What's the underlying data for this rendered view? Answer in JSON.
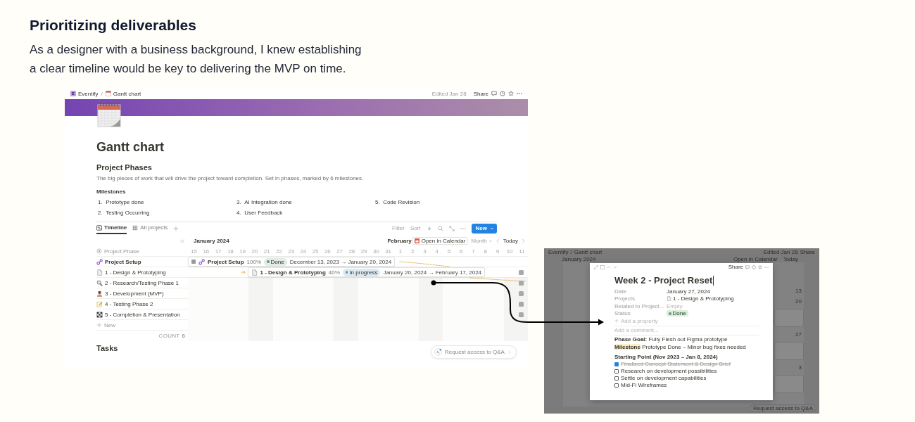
{
  "header": {
    "title": "Prioritizing deliverables",
    "paragraph": [
      "As a designer with a business background, I knew establishing",
      "a clear timeline would be key to delivering the MVP on time."
    ]
  },
  "gantt_page": {
    "breadcrumbs": [
      "Eventify",
      "Gantt chart"
    ],
    "breadcrumb_separator": "/",
    "edited": "Edited Jan 28",
    "share": "Share",
    "title": "Gantt chart",
    "section_title": "Project Phases",
    "description": "The big pieces of work that will drive the project toward completion. Set in phases,  marked by 6 milestones.",
    "milestones_label": "Milestones",
    "milestones": [
      {
        "number": "1.",
        "text": "Prototype done"
      },
      {
        "number": "2.",
        "text": "Testing Occurring"
      },
      {
        "number": "3.",
        "text": "AI Integration done"
      },
      {
        "number": "4.",
        "text": "User Feedback"
      },
      {
        "number": "5.",
        "text": "Code Revision"
      }
    ],
    "view_tabs": [
      {
        "label": "Timeline",
        "selected": true,
        "kind": "timeline"
      },
      {
        "label": "All projects",
        "selected": false,
        "kind": "table"
      }
    ],
    "toolbar": [
      "Filter",
      "Sort"
    ],
    "new_button": "New",
    "timeline": {
      "sidebar_header": "Project Phase",
      "phases": [
        {
          "label": "Project Setup",
          "kind": "link"
        },
        {
          "label": "1 - Design & Prototyping",
          "kind": "page"
        },
        {
          "label": "2 - Research/Testing Phase 1",
          "kind": "search"
        },
        {
          "label": "3 - Development (MVP)",
          "kind": "person"
        },
        {
          "label": "4 - Testing Phase 2",
          "kind": "memo"
        },
        {
          "label": "5 - Completion & Presentation",
          "kind": "flag"
        }
      ],
      "new_row": "New",
      "count_label": "COUNT",
      "count": "6",
      "months": [
        "January 2024",
        "February"
      ],
      "open_calendar": "Open in Calendar",
      "view_mode": "Month",
      "today": "Today",
      "days": [
        "15",
        "16",
        "17",
        "18",
        "19",
        "20",
        "21",
        "22",
        "23",
        "24",
        "25",
        "26",
        "27",
        "28",
        "29",
        "30",
        "31",
        "1",
        "2",
        "3",
        "4",
        "5",
        "6",
        "7",
        "8",
        "9",
        "10",
        "11"
      ],
      "bars": [
        {
          "name": "Project Setup",
          "kind": "link",
          "progress": "100%",
          "status": "Done",
          "color": "#6c9b7d",
          "dates": "December 13, 2023 → January 20, 2024"
        },
        {
          "name": "1 - Design & Prototyping",
          "kind": "page",
          "progress": "40%",
          "status": "In progress",
          "color": "#5b97bd",
          "dates": "January 20, 2024 → February 17, 2024"
        }
      ]
    },
    "qa_button": "Request access to Q&A",
    "next_section": "Tasks"
  },
  "task_page": {
    "breadcrumbs": [
      "Eventify",
      "Gantt chart"
    ],
    "breadcrumb_separator": "/",
    "edited": "Edited Jan 28",
    "share": "Share",
    "month": "January 2024",
    "open_calendar": "Open in Calendar",
    "today": "Today",
    "calendar_items": [
      {
        "kind": "day",
        "text": "13"
      },
      {
        "kind": "day",
        "text": "20"
      },
      {
        "kind": "card"
      },
      {
        "kind": "day",
        "text": "27"
      },
      {
        "kind": "card"
      },
      {
        "kind": "day",
        "text": "3"
      },
      {
        "kind": "card"
      }
    ],
    "qa_button": "Request access to Q&A",
    "modal": {
      "share": "Share",
      "title": "Week 2 - Project Reset",
      "properties": [
        {
          "label": "Date",
          "kind": "date",
          "value": "January 27, 2024"
        },
        {
          "label": "Projects",
          "kind": "relation",
          "value": "1 - Design & Prototyping"
        },
        {
          "label": "Related to Project...",
          "kind": "empty",
          "value": "Empty"
        },
        {
          "label": "Status",
          "kind": "status",
          "value": "Done"
        }
      ],
      "add_property": "Add a property",
      "comment_placeholder": "Add a comment...",
      "goal": "**Phase Goal:** Fully Flesh out Figma prototype",
      "milestone_label": "Milestone",
      "milestone_text": "Prototype Done – Minor bug fixes needed",
      "checklist_title": "Starting Point (Nov 2023 – Jan 8, 2024)",
      "checklist": [
        {
          "text": "Finalized Concept Statement & Design Brief",
          "checked": true
        },
        {
          "text": "Research on development possibilities",
          "checked": false
        },
        {
          "text": "Settle on development capabilities",
          "checked": false
        },
        {
          "text": "Mid-Fi Wireframes",
          "checked": false
        }
      ]
    }
  }
}
